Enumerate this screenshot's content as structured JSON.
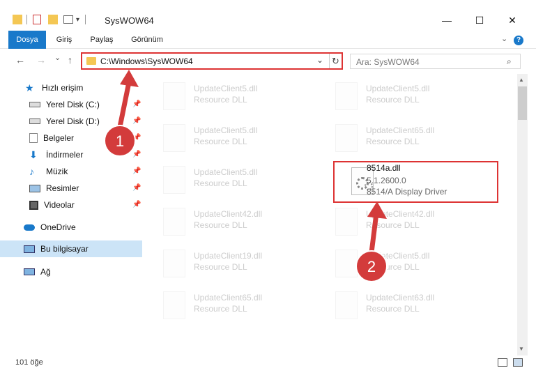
{
  "window": {
    "title": "SysWOW64",
    "minimize": "—",
    "maximize": "☐",
    "close": "✕"
  },
  "ribbon": {
    "tabs": [
      "Dosya",
      "Giriş",
      "Paylaş",
      "Görünüm"
    ],
    "help": "?"
  },
  "nav": {
    "back": "←",
    "forward": "→",
    "recent": "⌄",
    "up": "↑",
    "address": "C:\\Windows\\SysWOW64",
    "dropdown": "⌄",
    "refresh": "↻",
    "search_placeholder": "Ara: SysWOW64"
  },
  "sidebar": {
    "quick_access": "Hızlı erişim",
    "items": [
      {
        "label": "Yerel Disk (C:)",
        "icon": "drive-icon"
      },
      {
        "label": "Yerel Disk (D:)",
        "icon": "drive-icon"
      },
      {
        "label": "Belgeler",
        "icon": "documents-icon"
      },
      {
        "label": "İndirmeler",
        "icon": "downloads-icon"
      },
      {
        "label": "Müzik",
        "icon": "music-icon"
      },
      {
        "label": "Resimler",
        "icon": "pictures-icon"
      },
      {
        "label": "Videolar",
        "icon": "videos-icon"
      }
    ],
    "onedrive": "OneDrive",
    "this_pc": "Bu bilgisayar",
    "network": "Ağ"
  },
  "files": [
    {
      "name": "UpdateClient5.dll",
      "type": "Resource DLL"
    },
    {
      "name": "UpdateClient5.dll",
      "type": "Resource DLL"
    },
    {
      "name": "UpdateClient5.dll",
      "type": "Resource DLL"
    },
    {
      "name": "UpdateClient65.dll",
      "type": "Resource DLL"
    },
    {
      "name": "UpdateClient5.dll",
      "type": "Resource DLL"
    },
    {
      "name": "UpdateClient42.dll",
      "type": "Resource DLL"
    },
    {
      "name": "UpdateClient42.dll",
      "type": "Resource DLL"
    },
    {
      "name": "UpdateClient19.dll",
      "type": "Resource DLL"
    },
    {
      "name": "UpdateClient5.dll",
      "type": "Resource DLL"
    },
    {
      "name": "UpdateClient65.dll",
      "type": "Resource DLL"
    },
    {
      "name": "UpdateClient63.dll",
      "type": "Resource DLL"
    }
  ],
  "highlighted_file": {
    "name": "8514a.dll",
    "version": "5.1.2600.0",
    "description": "8514/A Display Driver"
  },
  "callouts": [
    "1",
    "2"
  ],
  "status": {
    "count": "101 öğe"
  },
  "colors": {
    "accent": "#1979ca",
    "callout": "#d33b3b",
    "selection": "#cce4f7"
  }
}
